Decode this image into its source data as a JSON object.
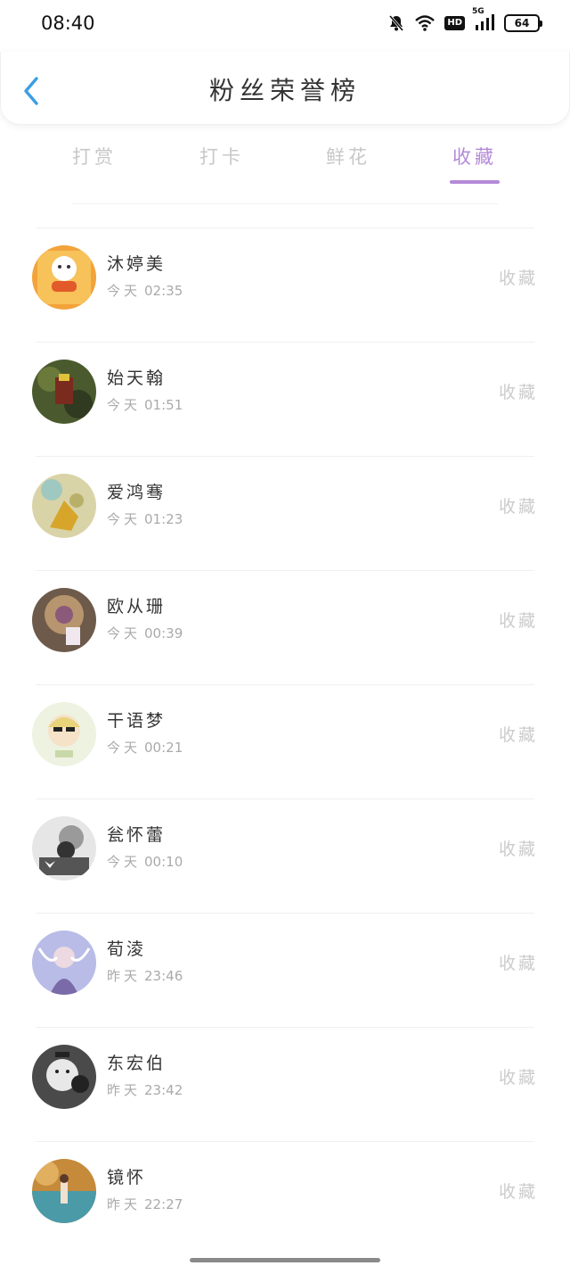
{
  "status_bar": {
    "time": "08:40",
    "network": "5G",
    "hd": "HD",
    "battery": "64"
  },
  "header": {
    "title": "粉丝荣誉榜"
  },
  "tabs": [
    {
      "label": "打赏",
      "active": false
    },
    {
      "label": "打卡",
      "active": false
    },
    {
      "label": "鲜花",
      "active": false
    },
    {
      "label": "收藏",
      "active": true
    }
  ],
  "colors": {
    "accent": "#b48ad8",
    "back_icon": "#3a9ee4",
    "muted_text": "#aaaaaa"
  },
  "fans": [
    {
      "name": "沐婷美",
      "day": "今天",
      "time": "02:35",
      "action": "收藏",
      "avatar": "avatar-1"
    },
    {
      "name": "始天翰",
      "day": "今天",
      "time": "01:51",
      "action": "收藏",
      "avatar": "avatar-2"
    },
    {
      "name": "爱鸿骞",
      "day": "今天",
      "time": "01:23",
      "action": "收藏",
      "avatar": "avatar-3"
    },
    {
      "name": "欧从珊",
      "day": "今天",
      "time": "00:39",
      "action": "收藏",
      "avatar": "avatar-4"
    },
    {
      "name": "干语梦",
      "day": "今天",
      "time": "00:21",
      "action": "收藏",
      "avatar": "avatar-5"
    },
    {
      "name": "瓮怀蕾",
      "day": "今天",
      "time": "00:10",
      "action": "收藏",
      "avatar": "avatar-6"
    },
    {
      "name": "荀淩",
      "day": "昨天",
      "time": "23:46",
      "action": "收藏",
      "avatar": "avatar-7"
    },
    {
      "name": "东宏伯",
      "day": "昨天",
      "time": "23:42",
      "action": "收藏",
      "avatar": "avatar-8"
    },
    {
      "name": "镜怀",
      "day": "昨天",
      "time": "22:27",
      "action": "收藏",
      "avatar": "avatar-9"
    }
  ]
}
